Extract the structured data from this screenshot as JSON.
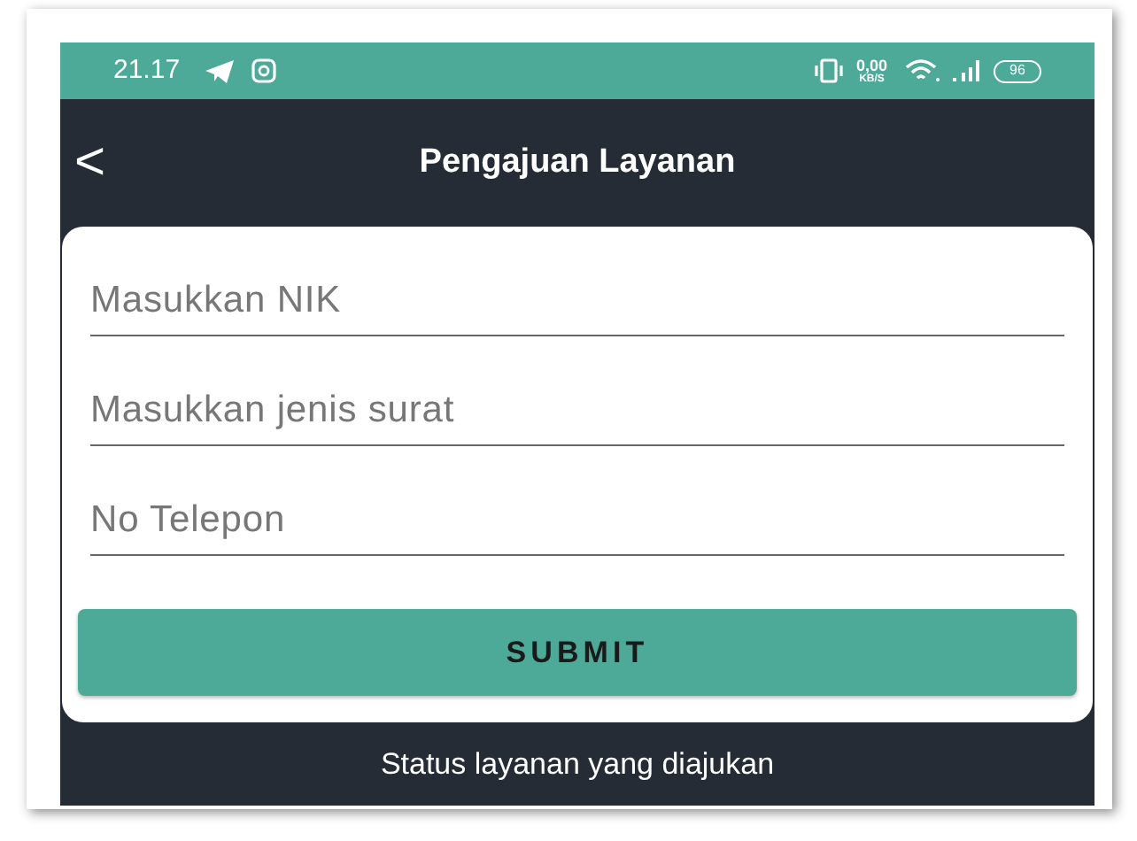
{
  "status_bar": {
    "time": "21.17",
    "net_speed": "0,00",
    "net_unit": "KB/S",
    "battery": "96"
  },
  "header": {
    "back": "<",
    "title": "Pengajuan Layanan"
  },
  "form": {
    "fields": [
      {
        "placeholder": "Masukkan NIK"
      },
      {
        "placeholder": "Masukkan jenis surat"
      },
      {
        "placeholder": "No Telepon"
      }
    ],
    "submit": "SUBMIT"
  },
  "footer": {
    "text": "Status layanan yang diajukan"
  }
}
